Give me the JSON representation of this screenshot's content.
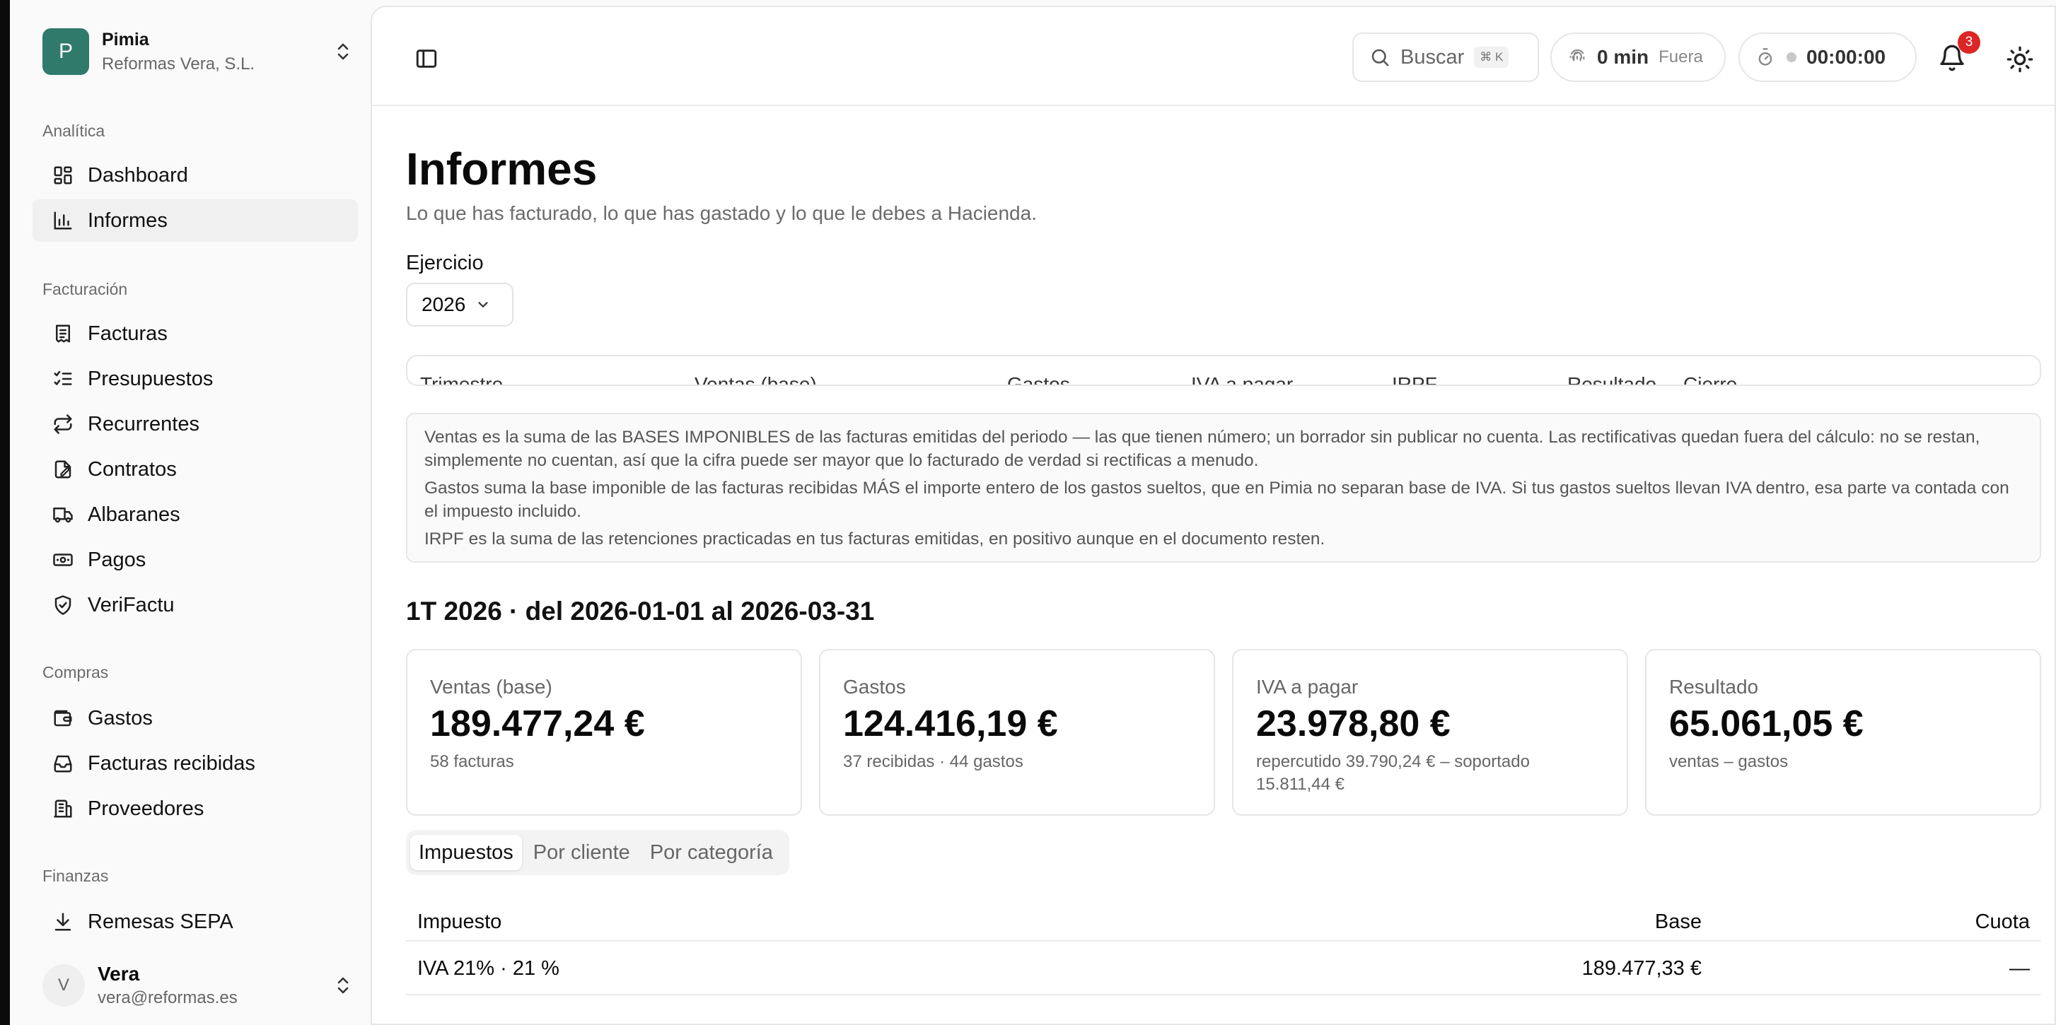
{
  "org": {
    "initial": "P",
    "name": "Pimia",
    "company": "Reformas Vera, S.L."
  },
  "sidebar": {
    "sections": [
      {
        "label": "Analítica",
        "items": [
          {
            "label": "Dashboard",
            "icon": "dashboard-icon"
          },
          {
            "label": "Informes",
            "icon": "chart-icon",
            "active": true
          }
        ]
      },
      {
        "label": "Facturación",
        "items": [
          {
            "label": "Facturas",
            "icon": "invoice-icon"
          },
          {
            "label": "Presupuestos",
            "icon": "checklist-icon"
          },
          {
            "label": "Recurrentes",
            "icon": "repeat-icon"
          },
          {
            "label": "Contratos",
            "icon": "contract-icon"
          },
          {
            "label": "Albaranes",
            "icon": "truck-icon"
          },
          {
            "label": "Pagos",
            "icon": "banknote-icon"
          },
          {
            "label": "VeriFactu",
            "icon": "shield-check-icon"
          }
        ]
      },
      {
        "label": "Compras",
        "items": [
          {
            "label": "Gastos",
            "icon": "wallet-icon"
          },
          {
            "label": "Facturas recibidas",
            "icon": "inbox-icon"
          },
          {
            "label": "Proveedores",
            "icon": "building-icon"
          }
        ]
      },
      {
        "label": "Finanzas",
        "items": [
          {
            "label": "Remesas SEPA",
            "icon": "download-icon"
          }
        ]
      }
    ]
  },
  "user": {
    "initial": "V",
    "name": "Vera",
    "email": "vera@reformas.es"
  },
  "topbar": {
    "search_label": "Buscar",
    "search_shortcut": "⌘ K",
    "timer_value": "0 min",
    "timer_status": "Fuera",
    "clock_value": "00:00:00",
    "notifications_count": "3"
  },
  "page": {
    "title": "Informes",
    "subtitle": "Lo que has facturado, lo que has gastado y lo que le debes a Hacienda.",
    "fiscal_year_label": "Ejercicio",
    "fiscal_year_value": "2026"
  },
  "quarter_table": {
    "headers": [
      "Trimestre",
      "Ventas (base)",
      "Gastos",
      "IVA a pagar",
      "IRPF",
      "Resultado",
      "Cierre"
    ]
  },
  "notes": [
    "Ventas es la suma de las BASES IMPONIBLES de las facturas emitidas del periodo — las que tienen número; un borrador sin publicar no cuenta. Las rectificativas quedan fuera del cálculo: no se restan, simplemente no cuentan, así que la cifra puede ser mayor que lo facturado de verdad si rectificas a menudo.",
    "Gastos suma la base imponible de las facturas recibidas MÁS el importe entero de los gastos sueltos, que en Pimia no separan base de IVA. Si tus gastos sueltos llevan IVA dentro, esa parte va contada con el impuesto incluido.",
    "IRPF es la suma de las retenciones practicadas en tus facturas emitidas, en positivo aunque en el documento resten."
  ],
  "period": {
    "heading": "1T 2026 · del 2026-01-01 al 2026-03-31"
  },
  "cards": [
    {
      "label": "Ventas (base)",
      "value": "189.477,24 €",
      "sub": "58 facturas"
    },
    {
      "label": "Gastos",
      "value": "124.416,19 €",
      "sub": "37 recibidas · 44 gastos"
    },
    {
      "label": "IVA a pagar",
      "value": "23.978,80 €",
      "sub": "repercutido 39.790,24 € – soportado 15.811,44 €"
    },
    {
      "label": "Resultado",
      "value": "65.061,05 €",
      "sub": "ventas – gastos"
    }
  ],
  "tabs": [
    "Impuestos",
    "Por cliente",
    "Por categoría"
  ],
  "tax_table": {
    "headers": [
      "Impuesto",
      "Base",
      "Cuota"
    ],
    "rows": [
      [
        "IVA 21% · 21 %",
        "189.477,33 €",
        "—"
      ]
    ]
  }
}
